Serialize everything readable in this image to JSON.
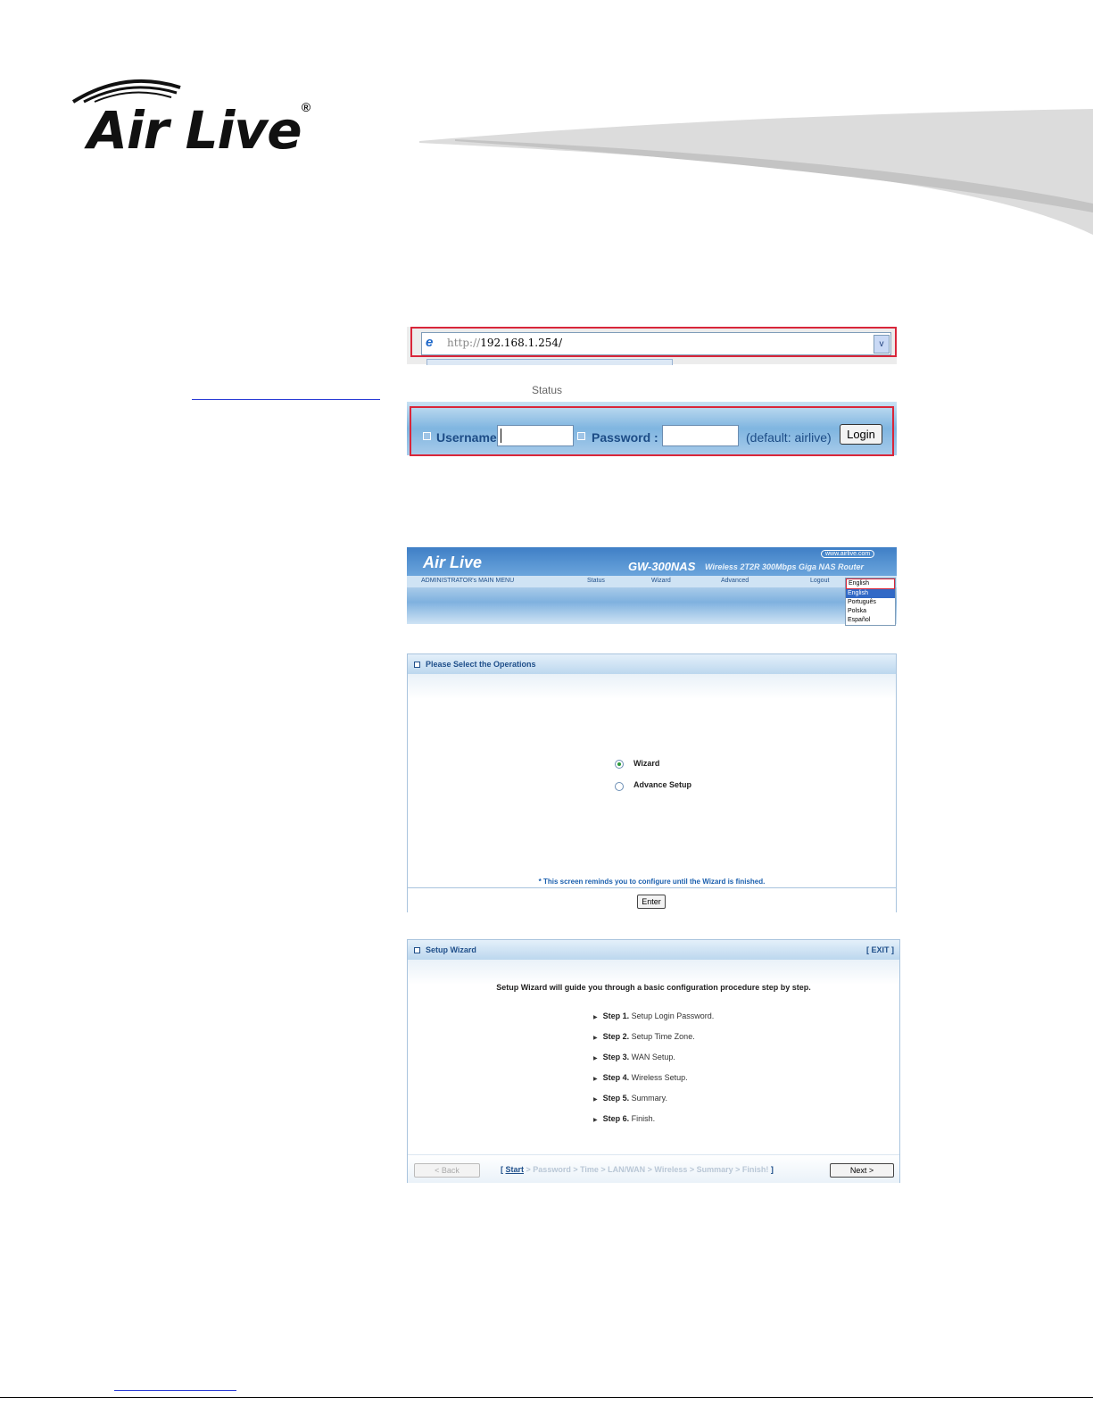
{
  "brand": {
    "logo": "Air Live",
    "registered": "®"
  },
  "address_bar": {
    "url_prefix": "http://",
    "url_host": "192.168.1.254/",
    "dropdown_glyph": "v"
  },
  "login": {
    "header_fragment": "Status",
    "username_label": "Username",
    "password_label": "Password :",
    "default_hint": "(default: airlive)",
    "login_button": "Login"
  },
  "router_header": {
    "logo": "Air Live",
    "model": "GW-300NAS",
    "subtitle": "Wireless 2T2R 300Mbps Giga NAS Router",
    "website": "www.airlive.com",
    "menu_title": "ADMINISTRATOR's MAIN MENU",
    "menu": [
      "Status",
      "Wizard",
      "Advanced",
      "Logout"
    ],
    "language_selected": "English",
    "language_options": [
      "English",
      "Português",
      "Polska",
      "Español"
    ]
  },
  "operations": {
    "title": "Please Select the Operations",
    "options": [
      "Wizard",
      "Advance Setup"
    ],
    "selected": "Wizard",
    "note": "* This screen reminds you to configure until the Wizard is finished.",
    "enter_button": "Enter"
  },
  "setup_wizard": {
    "title": "Setup Wizard",
    "exit": "[ EXIT ]",
    "intro": "Setup Wizard will guide you through a basic configuration procedure step by step.",
    "steps": [
      {
        "num": "Step  1.",
        "text": "Setup Login Password."
      },
      {
        "num": "Step  2.",
        "text": "Setup Time Zone."
      },
      {
        "num": "Step  3.",
        "text": "WAN Setup."
      },
      {
        "num": "Step  4.",
        "text": "Wireless Setup."
      },
      {
        "num": "Step  5.",
        "text": "Summary."
      },
      {
        "num": "Step  6.",
        "text": "Finish."
      }
    ],
    "back_button": "< Back",
    "next_button": "Next >",
    "crumb_open": "[",
    "crumb_current": "Start",
    "crumb_rest": "> Password > Time > LAN/WAN > Wireless > Summary > Finish!",
    "crumb_close": "]"
  }
}
